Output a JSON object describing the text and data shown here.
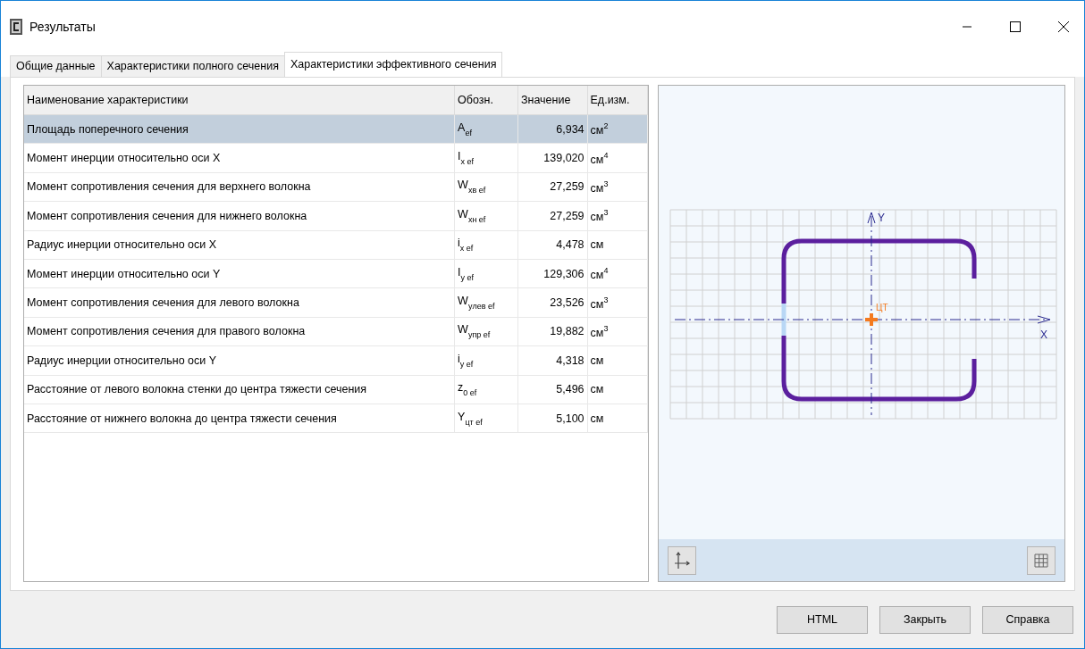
{
  "window": {
    "title": "Результаты"
  },
  "tabs": [
    {
      "label": "Общие данные",
      "selected": false
    },
    {
      "label": "Характеристики полного сечения",
      "selected": false
    },
    {
      "label": "Характеристики эффективного сечения",
      "selected": true
    }
  ],
  "table": {
    "columns": [
      "Наименование характеристики",
      "Обозн.",
      "Значение",
      "Ед.изм."
    ],
    "rows": [
      {
        "name": "Площадь поперечного сечения",
        "symbol": "A$_{ef}$",
        "value": "6,934",
        "unit": "см$^{2}$",
        "selected": true
      },
      {
        "name": "Момент инерции относительно оси X",
        "symbol": "I$_{x ef}$",
        "value": "139,020",
        "unit": "см$^{4}$",
        "selected": false
      },
      {
        "name": "Момент сопротивления сечения для верхнего волокна",
        "symbol": "W$_{xв ef}$",
        "value": "27,259",
        "unit": "см$^{3}$",
        "selected": false
      },
      {
        "name": "Момент сопротивления сечения для нижнего волокна",
        "symbol": "W$_{xн ef}$",
        "value": "27,259",
        "unit": "см$^{3}$",
        "selected": false
      },
      {
        "name": "Радиус инерции относительно оси X",
        "symbol": "i$_{x ef}$",
        "value": "4,478",
        "unit": "см",
        "selected": false
      },
      {
        "name": "Момент инерции относительно оси Y",
        "symbol": "I$_{y ef}$",
        "value": "129,306",
        "unit": "см$^{4}$",
        "selected": false
      },
      {
        "name": "Момент сопротивления сечения для левого волокна",
        "symbol": "W$_{yлев ef}$",
        "value": "23,526",
        "unit": "см$^{3}$",
        "selected": false
      },
      {
        "name": "Момент сопротивления сечения для правого волокна",
        "symbol": "W$_{yпр ef}$",
        "value": "19,882",
        "unit": "см$^{3}$",
        "selected": false
      },
      {
        "name": "Радиус инерции относительно оси Y",
        "symbol": "i$_{y ef}$",
        "value": "4,318",
        "unit": "см",
        "selected": false
      },
      {
        "name": "Расстояние от левого волокна стенки до центра тяжести сечения",
        "symbol": "z$_{0 ef}$",
        "value": "5,496",
        "unit": "см",
        "selected": false
      },
      {
        "name": "Расстояние от нижнего волокна до центра тяжести сечения",
        "symbol": "Y$_{цт ef}$",
        "value": "5,100",
        "unit": "см",
        "selected": false
      }
    ]
  },
  "drawing": {
    "y_axis_label": "Y",
    "x_axis_label": "X",
    "centroid_label": "ЦТ"
  },
  "buttons": [
    "HTML",
    "Закрыть",
    "Справка"
  ]
}
